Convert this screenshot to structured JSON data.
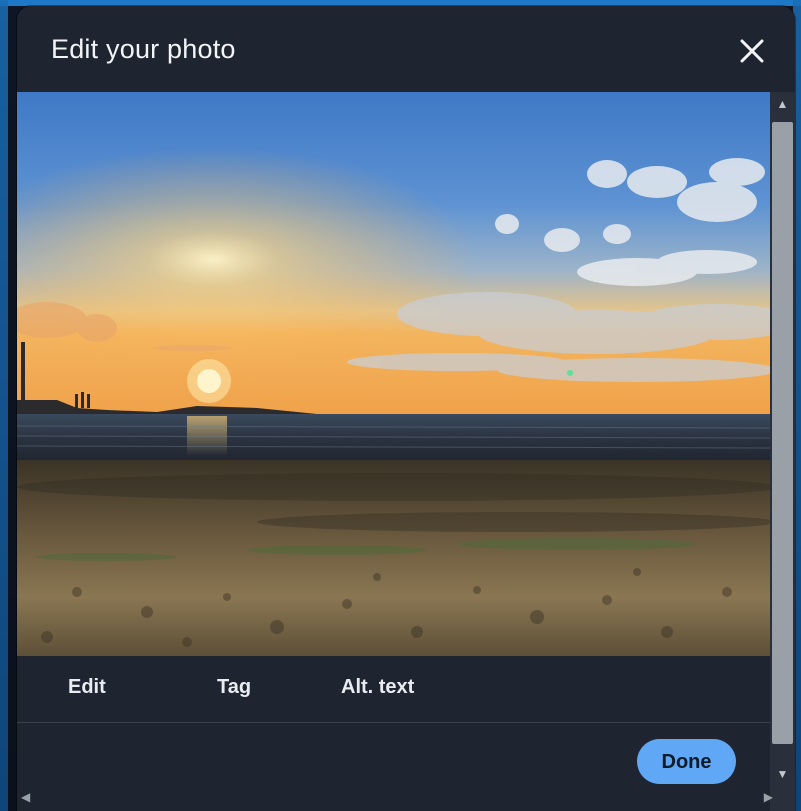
{
  "modal": {
    "title": "Edit your photo",
    "close_label": "Close"
  },
  "tabs": [
    {
      "label": "Edit"
    },
    {
      "label": "Tag"
    },
    {
      "label": "Alt. text"
    }
  ],
  "footer": {
    "done_label": "Done"
  },
  "icons": {
    "close": "close-icon",
    "scroll_up": "chevron-up-icon",
    "scroll_down": "chevron-down-icon",
    "scroll_left": "chevron-left-icon",
    "scroll_right": "chevron-right-icon"
  },
  "colors": {
    "modal_bg": "#1e2430",
    "accent": "#60a7f5",
    "text": "#f2f4f7"
  }
}
